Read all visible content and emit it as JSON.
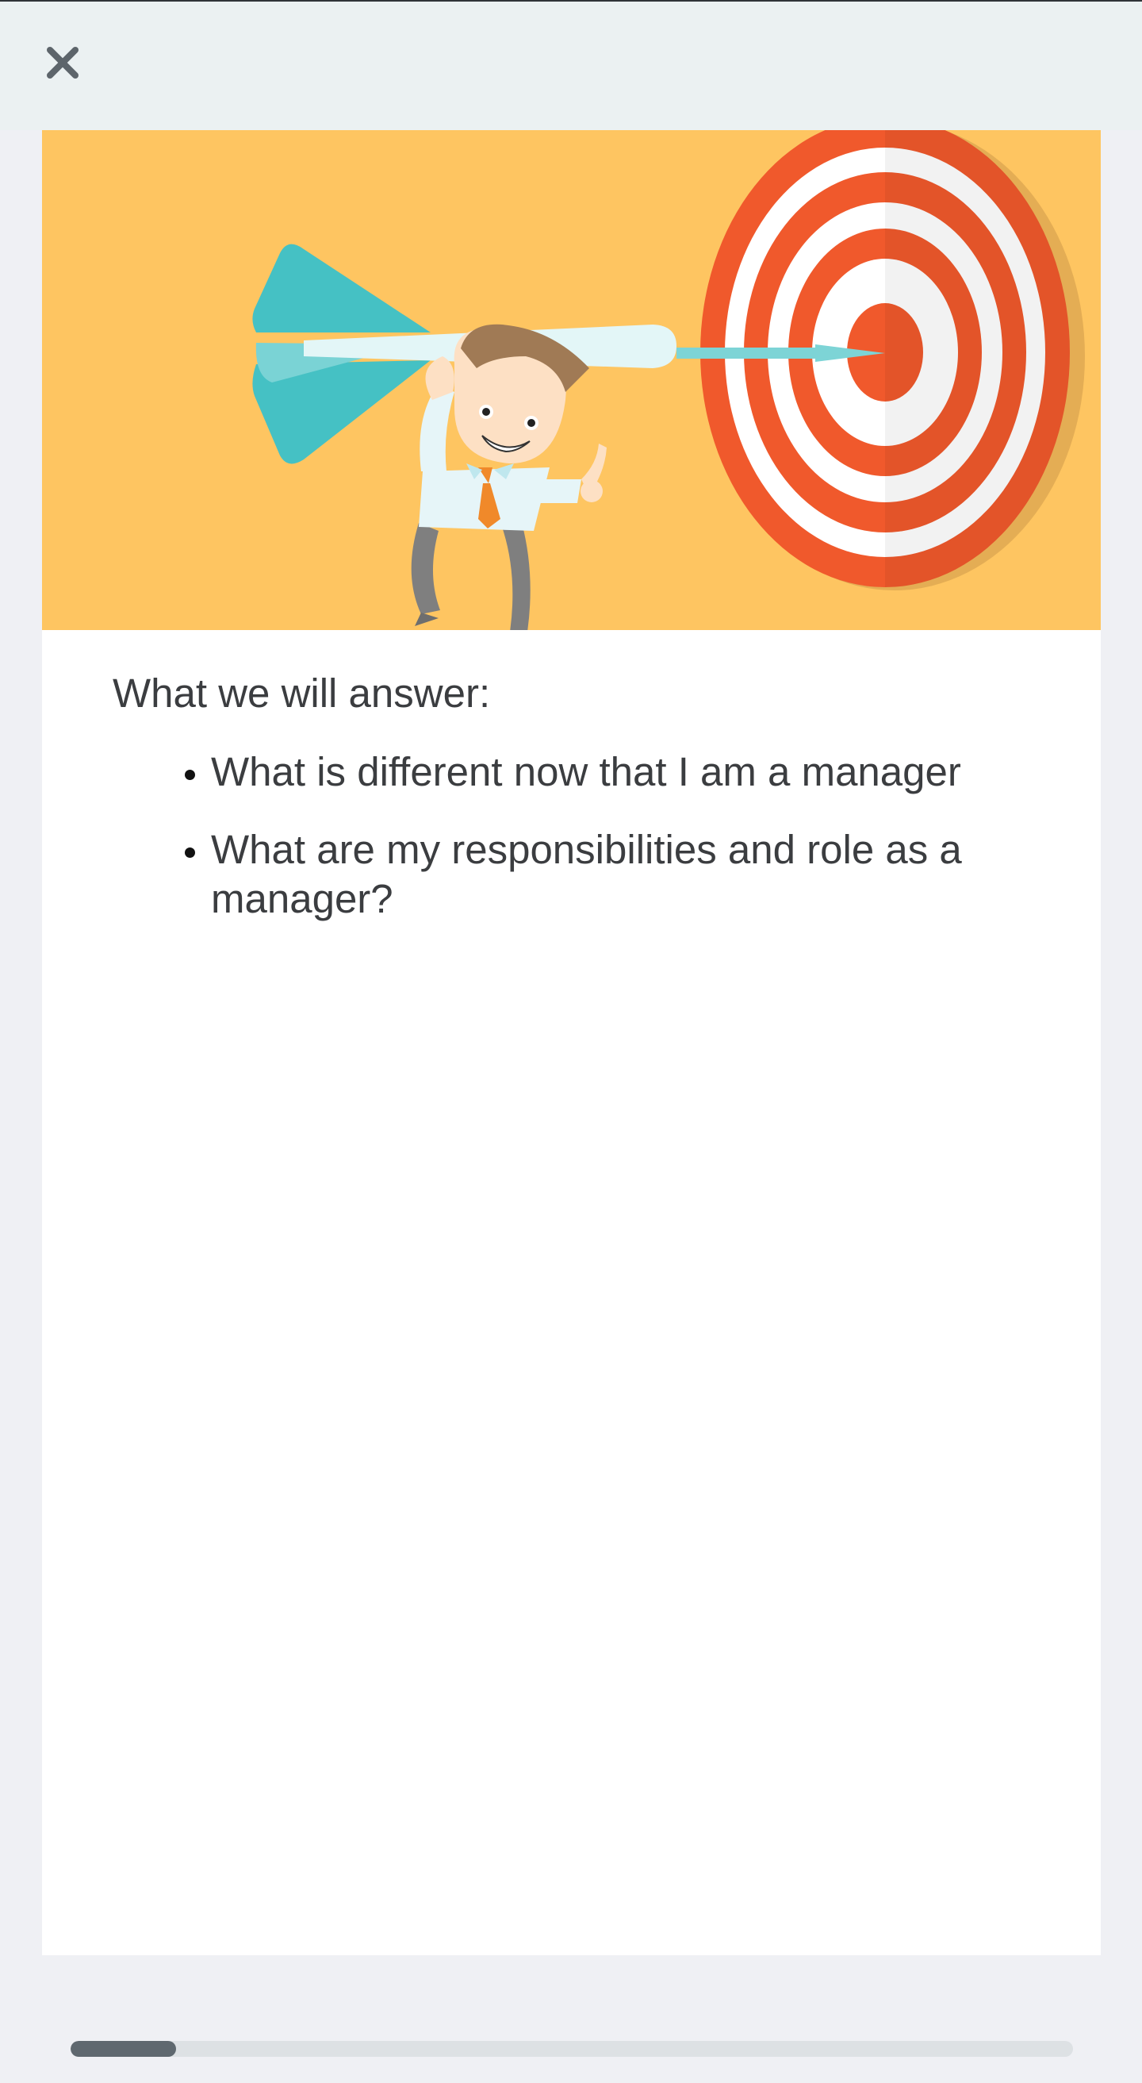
{
  "header": {
    "close_icon": "close-icon"
  },
  "hero": {
    "illustration": "businessman-carrying-dart-to-target",
    "background_color": "#fec561"
  },
  "content": {
    "heading": "What we will answer:",
    "bullets": [
      "What is different now that I am a manager",
      "What are my responsibilities and role as a manager?"
    ]
  },
  "progress": {
    "fraction": 0.105,
    "track_color": "#dde1e4",
    "fill_color": "#5f686f"
  }
}
